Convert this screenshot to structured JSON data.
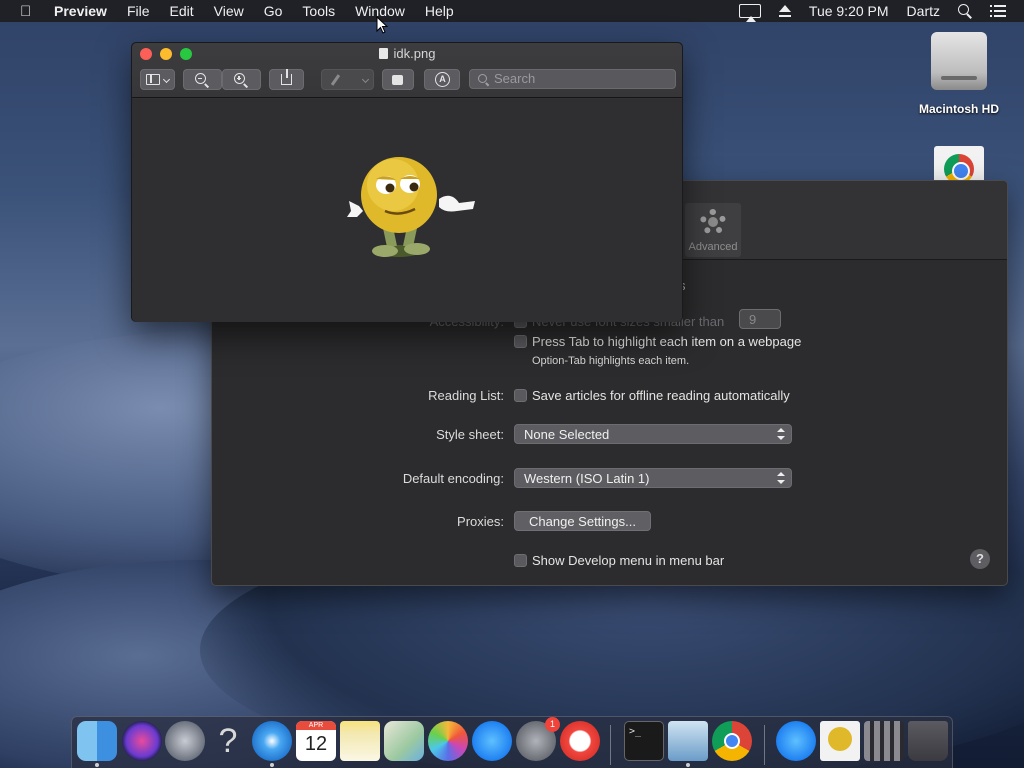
{
  "menubar": {
    "app_name": "Preview",
    "items": [
      "File",
      "Edit",
      "View",
      "Go",
      "Tools",
      "Window",
      "Help"
    ],
    "clock": "Tue 9:20 PM",
    "user": "Dartz"
  },
  "desktop": {
    "hd_label": "Macintosh HD"
  },
  "preview_window": {
    "title": "idk.png",
    "search_placeholder": "Search"
  },
  "prefs_window": {
    "advanced_tab": "Advanced",
    "partial_text_s": "s",
    "accessibility_label": "Accessibility:",
    "never_font_sizes": "Never use font sizes smaller than",
    "font_size_value": "9",
    "press_tab": "Press Tab to highlight each item on a webpage",
    "option_tab_note": "Option-Tab highlights each item.",
    "reading_list_label": "Reading List:",
    "reading_list_option": "Save articles for offline reading automatically",
    "style_sheet_label": "Style sheet:",
    "style_sheet_value": "None Selected",
    "encoding_label": "Default encoding:",
    "encoding_value": "Western (ISO Latin 1)",
    "proxies_label": "Proxies:",
    "proxies_button": "Change Settings...",
    "develop_menu": "Show Develop menu in menu bar",
    "help": "?"
  },
  "dock": {
    "calendar_month": "APR",
    "calendar_day": "12",
    "sysprefs_badge": "1",
    "help_glyph": "?",
    "terminal_prompt": ">_"
  },
  "colors": {
    "menubar_bg": "#1e1e22",
    "window_bg": "#2c2c2e",
    "close": "#fc5f57",
    "minimize": "#fdbb2e",
    "maximize": "#28c840",
    "smiley": "#e0b92a"
  }
}
